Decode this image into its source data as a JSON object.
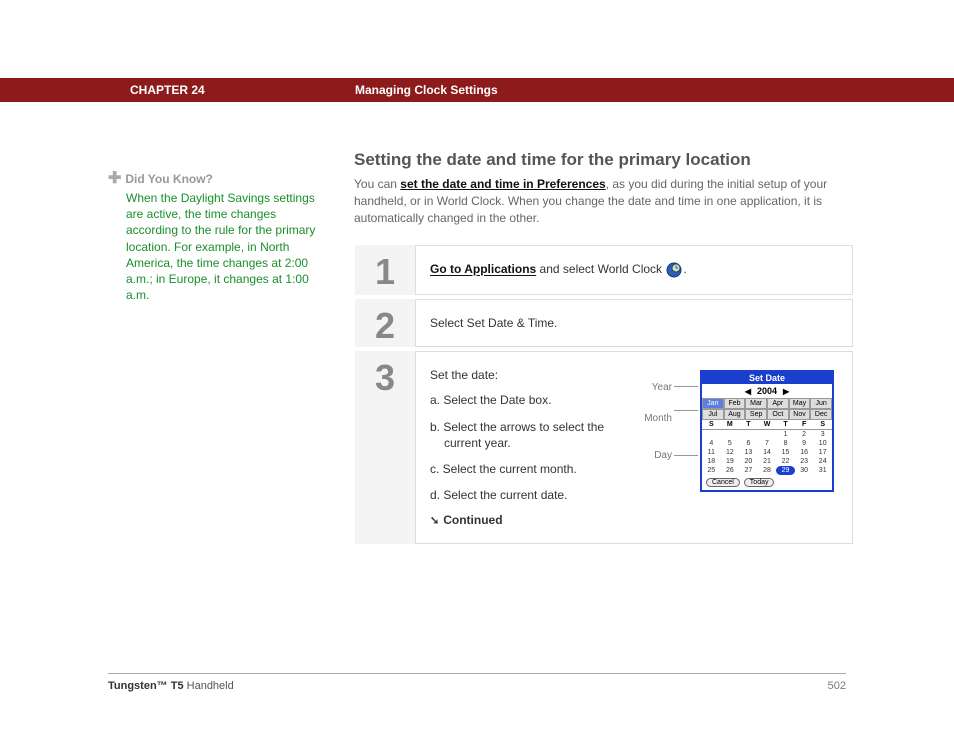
{
  "header": {
    "chapter": "CHAPTER 24",
    "section": "Managing Clock Settings"
  },
  "sidebar": {
    "title": "Did You Know?",
    "tip": "When the Daylight Savings settings are active, the time changes according to the rule for the primary location. For example, in North America, the time changes at 2:00 a.m.; in Europe, it changes at 1:00 a.m."
  },
  "main": {
    "heading": "Setting the date and time for the primary location",
    "intro_prefix": "You can ",
    "intro_link": "set the date and time in Preferences",
    "intro_suffix": ", as you did during the initial setup of your handheld, or in World Clock. When you change the date and time in one application, it is automatically changed in the other."
  },
  "steps": [
    {
      "num": "1",
      "link": "Go to Applications",
      "text_after": " and select World Clock ",
      "icon": "world-clock-icon",
      "text_end": "."
    },
    {
      "num": "2",
      "text": "Select Set Date & Time."
    },
    {
      "num": "3",
      "title": "Set the date:",
      "subs": [
        "a.  Select the Date box.",
        "b.  Select the arrows to select the current year.",
        "c.  Select the current month.",
        "d.  Select the current date."
      ],
      "continued": "Continued"
    }
  ],
  "calendar": {
    "labels": {
      "year": "Year",
      "month": "Month",
      "day": "Day"
    },
    "title": "Set Date",
    "year": "2004",
    "months": [
      "Jan",
      "Feb",
      "Mar",
      "Apr",
      "May",
      "Jun",
      "Jul",
      "Aug",
      "Sep",
      "Oct",
      "Nov",
      "Dec"
    ],
    "selected_month_index": 0,
    "day_headers": [
      "S",
      "M",
      "T",
      "W",
      "T",
      "F",
      "S"
    ],
    "grid": [
      [
        "",
        "",
        "",
        "",
        "1",
        "2",
        "3"
      ],
      [
        "4",
        "5",
        "6",
        "7",
        "8",
        "9",
        "10"
      ],
      [
        "11",
        "12",
        "13",
        "14",
        "15",
        "16",
        "17"
      ],
      [
        "18",
        "19",
        "20",
        "21",
        "22",
        "23",
        "24"
      ],
      [
        "25",
        "26",
        "27",
        "28",
        "29",
        "30",
        "31"
      ]
    ],
    "selected_day": "29",
    "buttons": [
      "Cancel",
      "Today"
    ]
  },
  "footer": {
    "product_bold": "Tungsten™ T5",
    "product_rest": " Handheld",
    "page": "502"
  }
}
